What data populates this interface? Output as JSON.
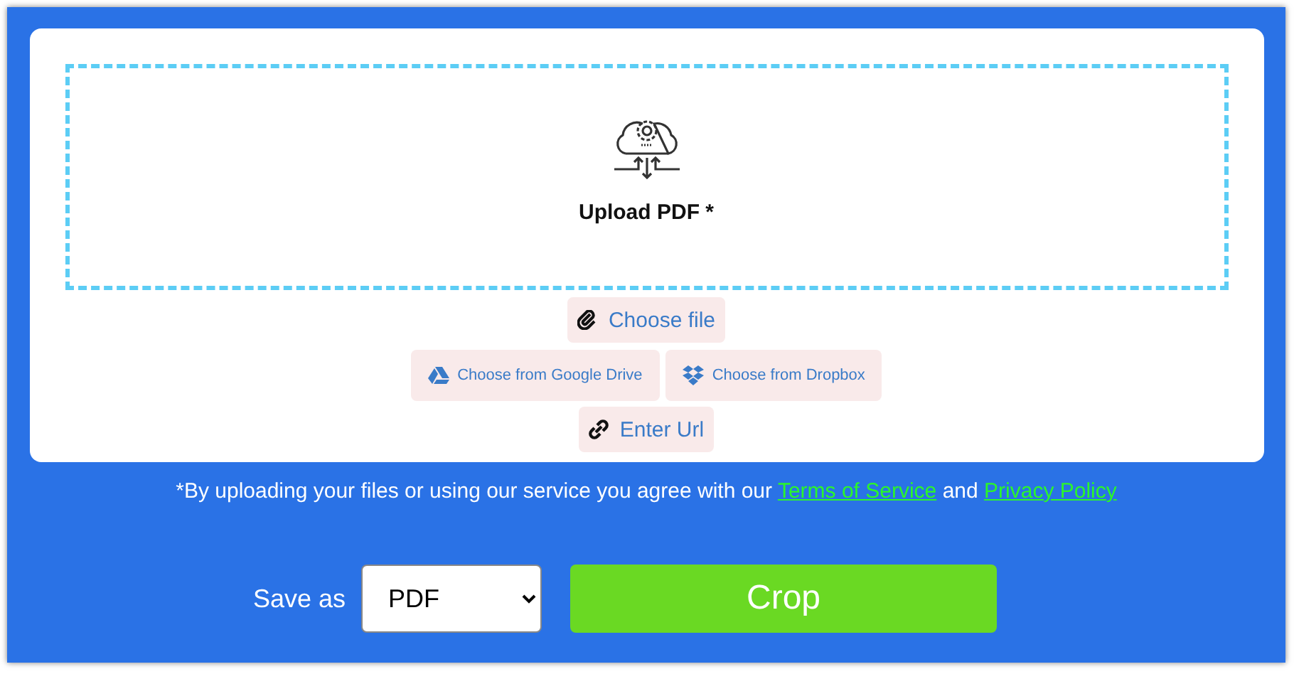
{
  "upload": {
    "label": "Upload PDF *"
  },
  "sources": [
    {
      "kind": "file",
      "label": "Choose file"
    },
    {
      "kind": "drive",
      "label": "Choose from Google Drive"
    },
    {
      "kind": "dropbox",
      "label": "Choose from Dropbox"
    },
    {
      "kind": "url",
      "label": "Enter Url"
    }
  ],
  "consent": {
    "text": "*By uploading your files or using our service you agree with our",
    "terms_link": "Terms of Service",
    "joiner": "and",
    "privacy_link": "Privacy Policy"
  },
  "save_as": {
    "label": "Save as",
    "value": "PDF"
  },
  "action": {
    "label": "Crop"
  }
}
